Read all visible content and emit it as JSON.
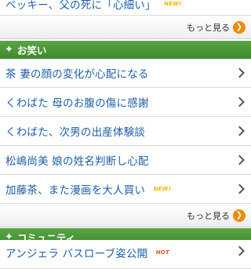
{
  "top_partial": {
    "text": "ベッキー、父の死に「心細い」",
    "badge": "NEW!"
  },
  "more_label": "もっと見る",
  "more_icon": "chevron-right-circle-icon",
  "sections": [
    {
      "title": "お笑い",
      "icon": "sparkle-icon",
      "items": [
        {
          "text": "茶 妻の顔の変化が心配になる"
        },
        {
          "text": "くわばた 母のお腹の傷に感謝"
        },
        {
          "text": "くわばた、次男の出産体験談"
        },
        {
          "text": "松嶋尚美 娘の姓名判断し心配"
        },
        {
          "text": "加藤茶、また漫画を大人買い",
          "badge": "NEW!"
        }
      ]
    },
    {
      "title": "コミュニティ",
      "icon": "sparkle-icon",
      "items": [
        {
          "text": "アンジェラ バスローブ姿公開",
          "badge": "HOT"
        }
      ]
    }
  ],
  "colors": {
    "section_header": "#4a9a3a",
    "link_text": "#1f5fa8",
    "more_icon": "#f08a00",
    "badge_new": "#f0b400",
    "badge_hot": "#e04a1a"
  }
}
